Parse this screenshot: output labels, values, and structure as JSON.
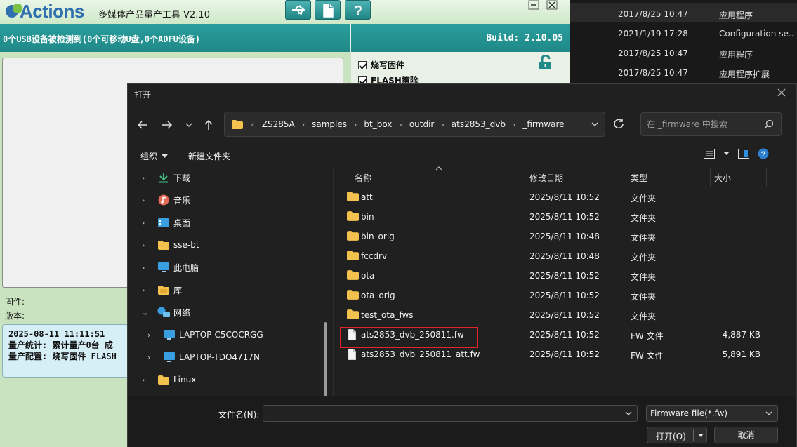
{
  "app": {
    "logo_text": "Actions",
    "subtitle": "多媒体产品量产工具 V2.10",
    "usb_status": "0个USB设备被检测到(0个可移动U盘,0个ADFU设备)",
    "build": "Build: 2.10.05",
    "options": [
      "烧写固件",
      "FLASH擦除"
    ],
    "firmware_label": "固件:",
    "version_label": "版本:",
    "log_lines": [
      "2025-08-11 11:11:51",
      "量产统计: 累计量产0台 成",
      "量产配置: 烧写固件 FLASH"
    ]
  },
  "bg_explorer": {
    "rows": [
      {
        "date": "2017/8/25 10:47",
        "type": "应用程序"
      },
      {
        "date": "2021/1/19 17:28",
        "type": "Configuration se..."
      },
      {
        "date": "2017/8/25 10:47",
        "type": "应用程序"
      },
      {
        "date": "2017/8/25 10:47",
        "type": "应用程序扩展"
      }
    ]
  },
  "dialog": {
    "title": "打开",
    "breadcrumb": [
      "ZS285A",
      "samples",
      "bt_box",
      "outdir",
      "ats2853_dvb",
      "_firmware"
    ],
    "search_placeholder": "在 _firmware 中搜索",
    "organize_label": "组织",
    "new_folder_label": "新建文件夹",
    "nav_items": [
      {
        "label": "下载",
        "icon": "download-icon"
      },
      {
        "label": "音乐",
        "icon": "music-icon"
      },
      {
        "label": "桌面",
        "icon": "desktop-icon"
      },
      {
        "label": "sse-bt",
        "icon": "folder-icon"
      },
      {
        "label": "此电脑",
        "icon": "computer-icon"
      },
      {
        "label": "库",
        "icon": "library-icon"
      },
      {
        "label": "网络",
        "icon": "network-icon"
      },
      {
        "label": "LAPTOP-C5COCRGG",
        "icon": "monitor-icon"
      },
      {
        "label": "LAPTOP-TDO4717N",
        "icon": "monitor-icon"
      },
      {
        "label": "Linux",
        "icon": "folder-icon"
      }
    ],
    "columns": {
      "name": "名称",
      "date": "修改日期",
      "type": "类型",
      "size": "大小"
    },
    "files": [
      {
        "name": "att",
        "date": "2025/8/11 10:52",
        "type": "文件夹",
        "size": "",
        "kind": "folder"
      },
      {
        "name": "bin",
        "date": "2025/8/11 10:52",
        "type": "文件夹",
        "size": "",
        "kind": "folder"
      },
      {
        "name": "bin_orig",
        "date": "2025/8/11 10:48",
        "type": "文件夹",
        "size": "",
        "kind": "folder"
      },
      {
        "name": "fccdrv",
        "date": "2025/8/11 10:48",
        "type": "文件夹",
        "size": "",
        "kind": "folder"
      },
      {
        "name": "ota",
        "date": "2025/8/11 10:52",
        "type": "文件夹",
        "size": "",
        "kind": "folder"
      },
      {
        "name": "ota_orig",
        "date": "2025/8/11 10:52",
        "type": "文件夹",
        "size": "",
        "kind": "folder"
      },
      {
        "name": "test_ota_fws",
        "date": "2025/8/11 10:52",
        "type": "文件夹",
        "size": "",
        "kind": "folder"
      },
      {
        "name": "ats2853_dvb_250811.fw",
        "date": "2025/8/11 10:52",
        "type": "FW 文件",
        "size": "4,887 KB",
        "kind": "file"
      },
      {
        "name": "ats2853_dvb_250811_att.fw",
        "date": "2025/8/11 10:52",
        "type": "FW 文件",
        "size": "5,891 KB",
        "kind": "file"
      }
    ],
    "filename_label": "文件名(N):",
    "filename_value": "",
    "filter_value": "Firmware file(*.fw)",
    "open_label": "打开(O)",
    "cancel_label": "取消"
  },
  "colors": {
    "highlight": "#e0242a",
    "teal": "#1f8988",
    "folder": "#f2c14e"
  }
}
